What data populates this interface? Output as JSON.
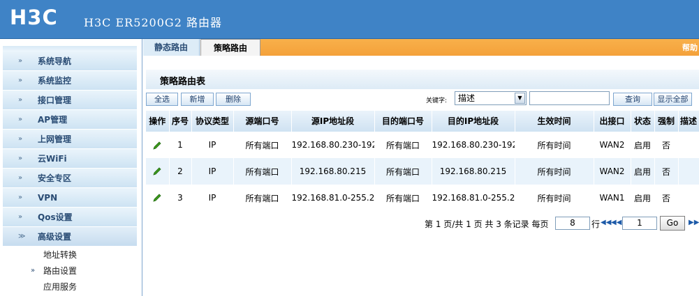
{
  "header": {
    "logo": "H3C",
    "title": "H3C ER5200G2 路由器"
  },
  "sidebar": {
    "items": [
      {
        "label": "系统导航",
        "icon": "chevron-right-icon"
      },
      {
        "label": "系统监控",
        "icon": "chevron-right-icon"
      },
      {
        "label": "接口管理",
        "icon": "chevron-right-icon"
      },
      {
        "label": "AP管理",
        "icon": "chevron-right-icon"
      },
      {
        "label": "上网管理",
        "icon": "chevron-right-icon"
      },
      {
        "label": "云WiFi",
        "icon": "chevron-right-icon"
      },
      {
        "label": "安全专区",
        "icon": "chevron-right-icon"
      },
      {
        "label": "VPN",
        "icon": "chevron-right-icon"
      },
      {
        "label": "Qos设置",
        "icon": "chevron-right-icon"
      },
      {
        "label": "高级设置",
        "icon": "chevron-down-icon"
      }
    ],
    "sub_items": [
      {
        "label": "地址转换",
        "selected": false
      },
      {
        "label": "路由设置",
        "selected": true
      },
      {
        "label": "应用服务",
        "selected": false
      }
    ]
  },
  "tabs": {
    "static": "静态路由",
    "policy": "策略路由",
    "help": "帮助"
  },
  "panel": {
    "title": "策略路由表",
    "select_all": "全选",
    "add": "新增",
    "delete": "删除",
    "keyword_label": "关键字:",
    "keyword_value": "描述",
    "search": "查询",
    "show_all": "显示全部"
  },
  "table": {
    "columns": [
      "操作",
      "序号",
      "协议类型",
      "源端口号",
      "源IP地址段",
      "目的端口号",
      "目的IP地址段",
      "生效时间",
      "出接口",
      "状态",
      "强制",
      "描述"
    ],
    "rows": [
      {
        "no": "1",
        "proto": "IP",
        "src_port": "所有端口",
        "src_ip": "192.168.80.230-192",
        "dst_port": "所有端口",
        "dst_ip": "192.168.80.230-192",
        "time": "所有时间",
        "iface": "WAN2",
        "status": "启用",
        "force": "否",
        "desc": ""
      },
      {
        "no": "2",
        "proto": "IP",
        "src_port": "所有端口",
        "src_ip": "192.168.80.215",
        "dst_port": "所有端口",
        "dst_ip": "192.168.80.215",
        "time": "所有时间",
        "iface": "WAN2",
        "status": "启用",
        "force": "否",
        "desc": ""
      },
      {
        "no": "3",
        "proto": "IP",
        "src_port": "所有端口",
        "src_ip": "192.168.81.0-255.2",
        "dst_port": "所有端口",
        "dst_ip": "192.168.81.0-255.2",
        "time": "所有时间",
        "iface": "WAN1",
        "status": "启用",
        "force": "否",
        "desc": ""
      }
    ]
  },
  "pager": {
    "summary": "第 1 页/共 1 页 共 3 条记录 每页",
    "per_page": "8",
    "row_unit": "行",
    "page_value": "1",
    "go": "Go"
  },
  "colors": {
    "header_blue": "#3f83c6",
    "orange_bar": "#f4a13a",
    "row_alt": "#e9f3fb",
    "pencil_green": "#3f9a1e"
  }
}
